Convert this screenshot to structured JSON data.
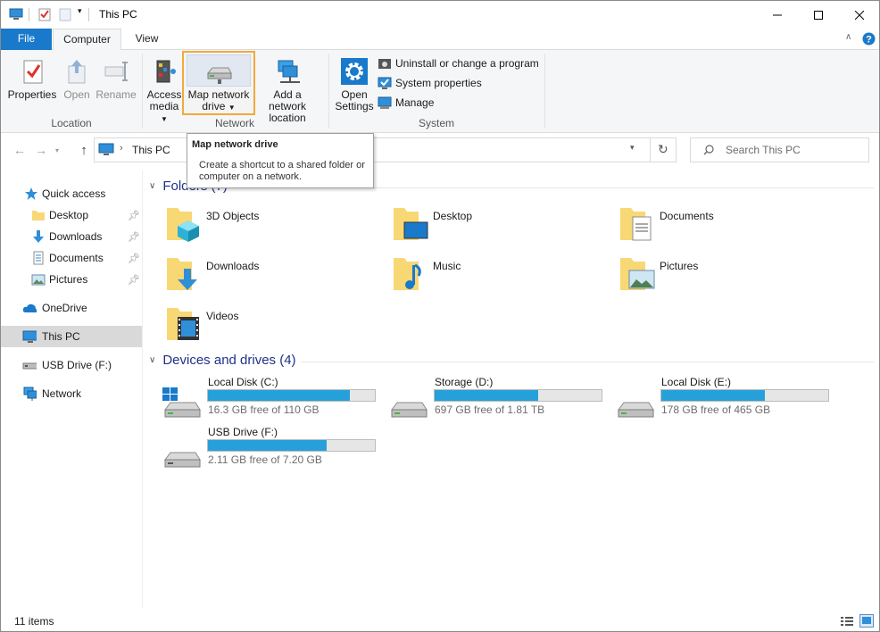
{
  "window": {
    "title": "This PC"
  },
  "tabs": {
    "file": "File",
    "computer": "Computer",
    "view": "View"
  },
  "ribbon": {
    "properties": "Properties",
    "open": "Open",
    "rename": "Rename",
    "access_media_1": "Access",
    "access_media_2": "media",
    "map_drive_1": "Map network",
    "map_drive_2": "drive",
    "add_location_1": "Add a network",
    "add_location_2": "location",
    "open_settings_1": "Open",
    "open_settings_2": "Settings",
    "uninstall": "Uninstall or change a program",
    "system_properties": "System properties",
    "manage": "Manage",
    "group_location": "Location",
    "group_network": "Network",
    "group_system": "System"
  },
  "tooltip": {
    "title": "Map network drive",
    "desc": "Create a shortcut to a shared folder or computer on a network."
  },
  "address": {
    "path": "This PC",
    "search_placeholder": "Search This PC"
  },
  "sidebar": {
    "items": [
      {
        "label": "Quick access",
        "icon": "star-icon"
      },
      {
        "label": "Desktop",
        "icon": "folder-icon",
        "pinned": true
      },
      {
        "label": "Downloads",
        "icon": "download-icon",
        "pinned": true
      },
      {
        "label": "Documents",
        "icon": "document-icon",
        "pinned": true
      },
      {
        "label": "Pictures",
        "icon": "picture-icon",
        "pinned": true
      },
      {
        "label": "OneDrive",
        "icon": "cloud-icon"
      },
      {
        "label": "This PC",
        "icon": "computer-icon",
        "selected": true
      },
      {
        "label": "USB Drive (F:)",
        "icon": "usb-drive-icon"
      },
      {
        "label": "Network",
        "icon": "network-icon"
      }
    ]
  },
  "folders": {
    "heading": "Folders (7)",
    "items": [
      "3D Objects",
      "Desktop",
      "Documents",
      "Downloads",
      "Music",
      "Pictures",
      "Videos"
    ]
  },
  "drives": {
    "heading": "Devices and drives (4)",
    "items": [
      {
        "name": "Local Disk (C:)",
        "free": "16.3 GB free of 110 GB",
        "used_fraction": 0.85
      },
      {
        "name": "Storage (D:)",
        "free": "697 GB free of 1.81 TB",
        "used_fraction": 0.62
      },
      {
        "name": "Local Disk (E:)",
        "free": "178 GB free of 465 GB",
        "used_fraction": 0.62
      },
      {
        "name": "USB Drive (F:)",
        "free": "2.11 GB free of 7.20 GB",
        "used_fraction": 0.71
      }
    ]
  },
  "status": {
    "items": "11 items"
  },
  "colors": {
    "accent": "#1979ca",
    "bar_fill": "#26a0da",
    "heading": "#1e3287",
    "highlight": "#f3a93b"
  }
}
